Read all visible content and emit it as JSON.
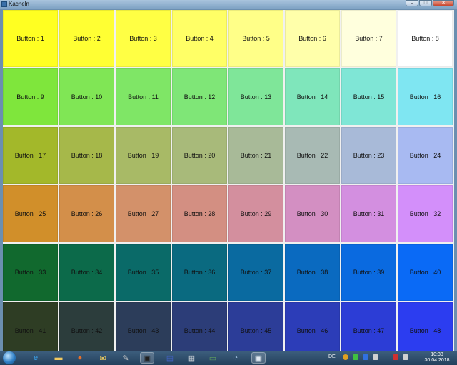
{
  "window": {
    "title": "Kacheln",
    "minimize": "–",
    "maximize": "□",
    "close": "✕"
  },
  "tiles": [
    {
      "label": "Button : 1",
      "color": "#ffff22"
    },
    {
      "label": "Button : 2",
      "color": "#ffff33"
    },
    {
      "label": "Button : 3",
      "color": "#ffff44"
    },
    {
      "label": "Button : 4",
      "color": "#ffff66"
    },
    {
      "label": "Button : 5",
      "color": "#ffff88"
    },
    {
      "label": "Button : 6",
      "color": "#ffffaa"
    },
    {
      "label": "Button : 7",
      "color": "#ffffdd"
    },
    {
      "label": "Button : 8",
      "color": "#ffffff"
    },
    {
      "label": "Button : 9",
      "color": "#7fe63c"
    },
    {
      "label": "Button : 10",
      "color": "#80e655"
    },
    {
      "label": "Button : 11",
      "color": "#7fe666"
    },
    {
      "label": "Button : 12",
      "color": "#7fe677"
    },
    {
      "label": "Button : 13",
      "color": "#7fe699"
    },
    {
      "label": "Button : 14",
      "color": "#7fe6bb"
    },
    {
      "label": "Button : 15",
      "color": "#7fe6d6"
    },
    {
      "label": "Button : 16",
      "color": "#7fe6f2"
    },
    {
      "label": "Button : 17",
      "color": "#a3b82a"
    },
    {
      "label": "Button : 18",
      "color": "#a6b84a"
    },
    {
      "label": "Button : 19",
      "color": "#a8ba66"
    },
    {
      "label": "Button : 20",
      "color": "#a8ba7a"
    },
    {
      "label": "Button : 21",
      "color": "#a8ba98"
    },
    {
      "label": "Button : 22",
      "color": "#a8bab4"
    },
    {
      "label": "Button : 23",
      "color": "#a8bad8"
    },
    {
      "label": "Button : 24",
      "color": "#a8baf2"
    },
    {
      "label": "Button : 25",
      "color": "#d18f2a"
    },
    {
      "label": "Button : 26",
      "color": "#d38f4a"
    },
    {
      "label": "Button : 27",
      "color": "#d3916a"
    },
    {
      "label": "Button : 28",
      "color": "#d38f82"
    },
    {
      "label": "Button : 29",
      "color": "#d38f9e"
    },
    {
      "label": "Button : 30",
      "color": "#d38fc2"
    },
    {
      "label": "Button : 31",
      "color": "#d38fe0"
    },
    {
      "label": "Button : 32",
      "color": "#d38ffa"
    },
    {
      "label": "Button : 33",
      "color": "#11692e"
    },
    {
      "label": "Button : 34",
      "color": "#0c6a4a"
    },
    {
      "label": "Button : 35",
      "color": "#0a6a68"
    },
    {
      "label": "Button : 36",
      "color": "#0a6a80"
    },
    {
      "label": "Button : 37",
      "color": "#0a6aa0"
    },
    {
      "label": "Button : 38",
      "color": "#0a6ac0"
    },
    {
      "label": "Button : 39",
      "color": "#0a6ae0"
    },
    {
      "label": "Button : 40",
      "color": "#0a6af6"
    },
    {
      "label": "Button : 41",
      "color": "#2e3d24"
    },
    {
      "label": "Button : 42",
      "color": "#2c3d3c"
    },
    {
      "label": "Button : 43",
      "color": "#2c3d5a"
    },
    {
      "label": "Button : 44",
      "color": "#2c3d78"
    },
    {
      "label": "Button : 45",
      "color": "#2c3d98"
    },
    {
      "label": "Button : 46",
      "color": "#2c3db8"
    },
    {
      "label": "Button : 47",
      "color": "#2c3dd6"
    },
    {
      "label": "Button : 48",
      "color": "#2c3df0"
    }
  ],
  "taskbar": {
    "icons": [
      {
        "name": "ie-icon",
        "glyph": "e",
        "color": "#3aa0e8"
      },
      {
        "name": "explorer-folder-icon",
        "glyph": "▬",
        "color": "#f0c860"
      },
      {
        "name": "firefox-icon",
        "glyph": "●",
        "color": "#e8702a"
      },
      {
        "name": "mail-icon",
        "glyph": "✉",
        "color": "#f2d060"
      },
      {
        "name": "tool-icon",
        "glyph": "✎",
        "color": "#c8c8c8"
      },
      {
        "name": "console-icon",
        "glyph": "▣",
        "color": "#202020"
      },
      {
        "name": "save-disk-icon",
        "glyph": "▤",
        "color": "#4060c0"
      },
      {
        "name": "server-icon",
        "glyph": "▦",
        "color": "#c0c8d0"
      },
      {
        "name": "monitor-icon",
        "glyph": "▭",
        "color": "#60a060"
      },
      {
        "name": "media-icon",
        "glyph": "◔",
        "color": "#a0c0e0"
      },
      {
        "name": "window-app-icon",
        "glyph": "▣",
        "color": "#e0e8f0"
      }
    ],
    "language": "DE",
    "time": "10:33",
    "date": "30.04.2018"
  }
}
